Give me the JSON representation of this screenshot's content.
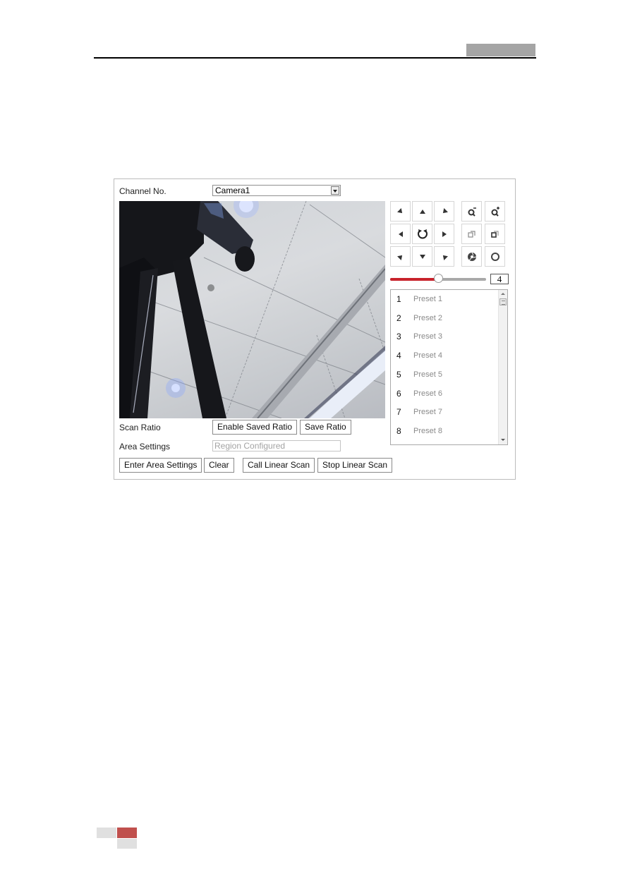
{
  "panel": {
    "channel_label": "Channel No.",
    "channel_select": {
      "value": "Camera1"
    },
    "ptz": {
      "direction_buttons": [
        {
          "name": "up-left",
          "icon": "arrow-up-left-icon"
        },
        {
          "name": "up",
          "icon": "arrow-up-icon"
        },
        {
          "name": "up-right",
          "icon": "arrow-up-right-icon"
        },
        {
          "name": "left",
          "icon": "arrow-left-icon"
        },
        {
          "name": "auto",
          "icon": "auto-pan-icon"
        },
        {
          "name": "right",
          "icon": "arrow-right-icon"
        },
        {
          "name": "down-left",
          "icon": "arrow-down-left-icon"
        },
        {
          "name": "down",
          "icon": "arrow-down-icon"
        },
        {
          "name": "down-right",
          "icon": "arrow-down-right-icon"
        }
      ],
      "lens_buttons": [
        {
          "name": "zoom-out",
          "icon": "zoom-out-icon"
        },
        {
          "name": "zoom-in",
          "icon": "zoom-in-icon"
        },
        {
          "name": "focus-near",
          "icon": "focus-near-icon"
        },
        {
          "name": "focus-far",
          "icon": "focus-far-icon"
        },
        {
          "name": "iris-close",
          "icon": "iris-close-icon"
        },
        {
          "name": "iris-open",
          "icon": "iris-open-icon"
        }
      ],
      "speed": {
        "value": "4",
        "min": 1,
        "max": 7,
        "fraction": 0.5
      }
    },
    "presets": [
      {
        "num": "1",
        "name": "Preset 1"
      },
      {
        "num": "2",
        "name": "Preset 2"
      },
      {
        "num": "3",
        "name": "Preset 3"
      },
      {
        "num": "4",
        "name": "Preset 4"
      },
      {
        "num": "5",
        "name": "Preset 5"
      },
      {
        "num": "6",
        "name": "Preset 6"
      },
      {
        "num": "7",
        "name": "Preset 7"
      },
      {
        "num": "8",
        "name": "Preset 8"
      }
    ],
    "scan_ratio_label": "Scan Ratio",
    "enable_saved_ratio_label": "Enable Saved Ratio",
    "save_ratio_label": "Save Ratio",
    "area_settings_label": "Area Settings",
    "area_settings_input": {
      "value": "",
      "placeholder": "Region Configured"
    },
    "enter_area_settings_label": "Enter Area Settings",
    "clear_label": "Clear",
    "call_linear_scan_label": "Call Linear Scan",
    "stop_linear_scan_label": "Stop Linear Scan"
  },
  "colors": {
    "accent_red": "#c8232c",
    "header_tab_gray": "#a5a5a5",
    "footer_red": "#c0504d"
  }
}
